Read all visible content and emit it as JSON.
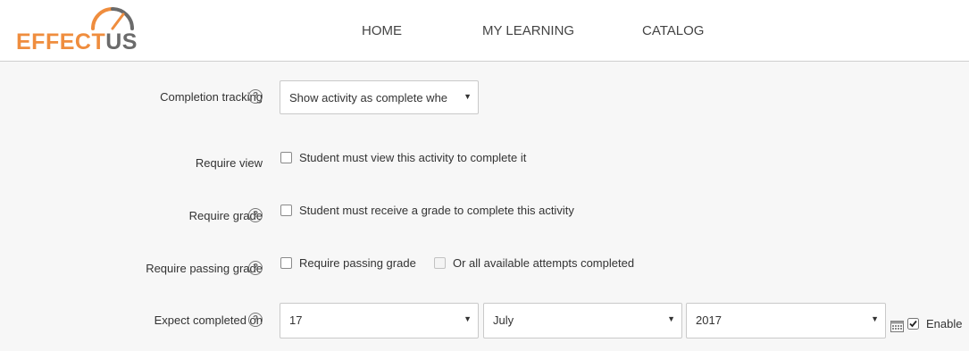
{
  "header": {
    "logo": {
      "part1": "EFFECT",
      "part2": "US"
    },
    "nav": [
      {
        "label": "HOME"
      },
      {
        "label": "MY LEARNING"
      },
      {
        "label": "CATALOG"
      }
    ]
  },
  "form": {
    "completion_tracking": {
      "label": "Completion tracking",
      "selected": "Show activity as complete whe"
    },
    "require_view": {
      "label": "Require view",
      "checkbox_label": "Student must view this activity to complete it",
      "checked": false
    },
    "require_grade": {
      "label": "Require grade",
      "checkbox_label": "Student must receive a grade to complete this activity",
      "checked": false
    },
    "require_passing_grade": {
      "label": "Require passing grade",
      "checkbox_label": "Require passing grade",
      "checked": false,
      "secondary_label": "Or all available attempts completed",
      "secondary_checked": false
    },
    "expect_completed": {
      "label": "Expect completed on",
      "day": "17",
      "month": "July",
      "year": "2017",
      "enable_label": "Enable",
      "enable_checked": true
    }
  },
  "colors": {
    "brand_orange": "#ef8d3e",
    "brand_gray": "#6b6b6b",
    "background": "#f7f7f7"
  }
}
